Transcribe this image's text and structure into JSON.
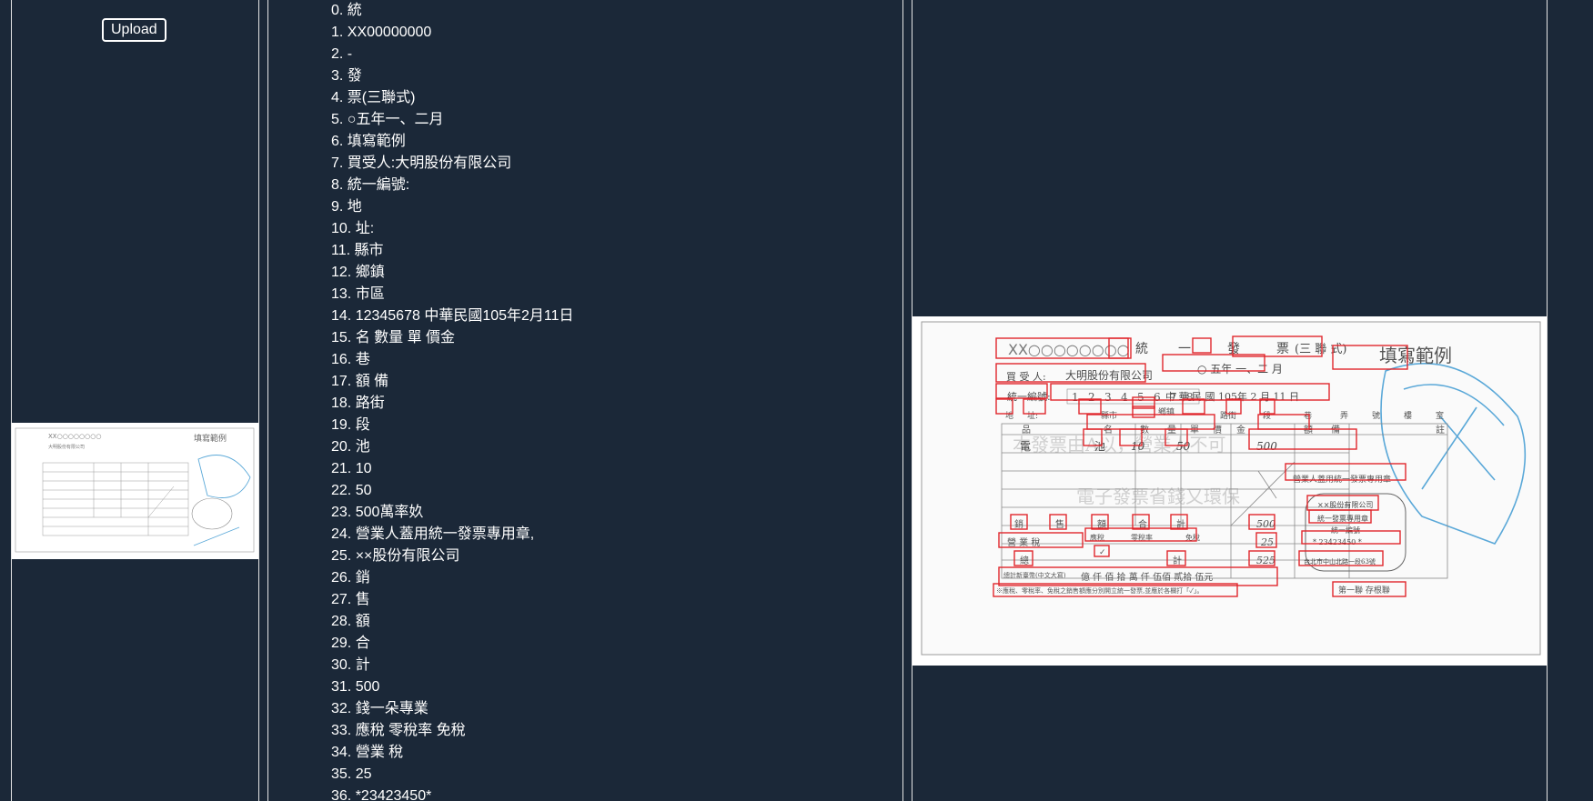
{
  "upload": {
    "label": "Upload"
  },
  "ocr_results": [
    "0. 統",
    "1. XX00000000",
    "2. -",
    "3. 發",
    "4. 票(三聯式)",
    "5. ○五年一、二月",
    "6. 填寫範例",
    "7. 買受人:大明股份有限公司",
    "8. 統一編號:",
    "9. 地",
    "10. 址:",
    "11. 縣市",
    "12. 鄉鎮",
    "13. 市區",
    "14. 12345678 中華民國105年2月11日",
    "15. 名 數量 單 價金",
    "16. 巷",
    "17. 額 備",
    "18. 路街",
    "19. 段",
    "20. 池",
    "21. 10",
    "22. 50",
    "23. 500萬率奺",
    "24. 營業人蓋用統一發票專用章,",
    "25. ××股份有限公司",
    "26. 銷",
    "27. 售",
    "28. 額",
    "29. 合",
    "30. 計",
    "31. 500",
    "32. 錢一朵專業",
    "33. 應稅 零稅率 免稅",
    "34. 營業 稅",
    "35. 25",
    "36. *23423450*"
  ],
  "invoice": {
    "serial": "XX○○○○○○○○",
    "title_chars": [
      "統",
      "一",
      "發",
      "票"
    ],
    "triplicate": "(三 聯 式)",
    "example": "填寫範例",
    "period": "○ 五年 一、二 月",
    "buyer_label": "買 受 人:",
    "buyer": "大明股份有限公司",
    "tax_id_label": "統一編號:",
    "tax_id_digits": [
      "1",
      "2",
      "3",
      "4",
      "5",
      "6",
      "7",
      "8"
    ],
    "date": "中 華 民 國 105年 2 月 11 日",
    "addr_labels": [
      "地",
      "址:",
      "縣市",
      "鄉鎮",
      "路街",
      "段",
      "巷",
      "弄",
      "號",
      "樓",
      "室"
    ],
    "columns": [
      "品",
      "名",
      "數",
      "量",
      "單",
      "價",
      "金",
      "額",
      "備",
      "註"
    ],
    "item": {
      "name": "電",
      "name2": "池",
      "qty": "10",
      "price": "50",
      "amount": "500"
    },
    "stamp_note": "營業人蓋用統一發票專用章",
    "seal_lines": [
      "××股份有限公司",
      "統一發票專用章",
      "統一編號",
      "* 23423450 *",
      "台北市中山北路一段63號"
    ],
    "sales_labels": [
      "銷",
      "售",
      "額",
      "合",
      "計"
    ],
    "sales_amount": "500",
    "tax_label": "營 業 稅",
    "tax_types": [
      "應稅",
      "零稅率",
      "免稅"
    ],
    "tax_check": "✓",
    "tax_amount": "25",
    "total_labels": [
      "總",
      "計"
    ],
    "total_amount": "525",
    "total_words_label": "總計新臺幣(中文大寫)",
    "total_words": "億 仟 佰 拾 萬 仟 伍佰 貳拾 伍元",
    "footnote": "※應稅、零稅率、免稅之銷售額應分別開立統一發票,並應於各欄打「✓」。",
    "stub": "第一聯 存根聯"
  },
  "colors": {
    "background": "#1b2838",
    "panel_border": "#e6e6e6",
    "bbox": "#e0262c",
    "stamp": "#5aa8d8",
    "print": "#4a4a4a"
  }
}
